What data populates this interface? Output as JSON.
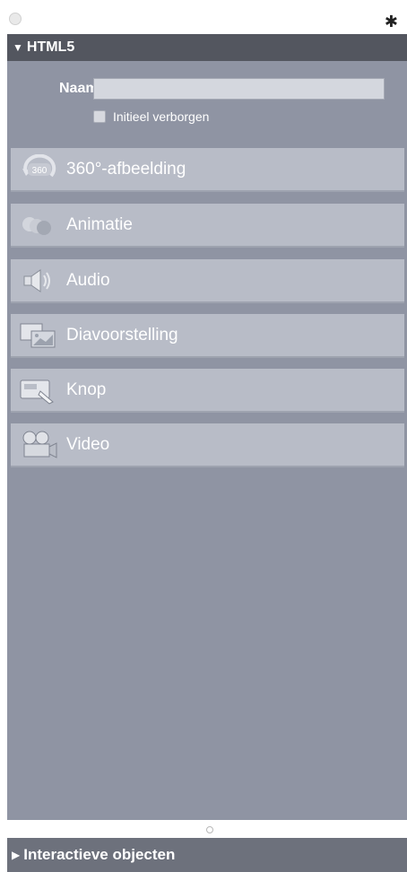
{
  "header": {
    "section_title": "HTML5"
  },
  "form": {
    "name_label": "Naam:",
    "name_value": "",
    "initial_hidden_label": "Initieel verborgen"
  },
  "items": [
    {
      "label": "360°-afbeelding",
      "icon": "rotate-360-icon"
    },
    {
      "label": "Animatie",
      "icon": "animation-icon"
    },
    {
      "label": "Audio",
      "icon": "speaker-icon"
    },
    {
      "label": "Diavoorstelling",
      "icon": "slideshow-icon"
    },
    {
      "label": "Knop",
      "icon": "button-hand-icon"
    },
    {
      "label": "Video",
      "icon": "video-camera-icon"
    }
  ],
  "footer": {
    "section_title": "Interactieve objecten"
  }
}
